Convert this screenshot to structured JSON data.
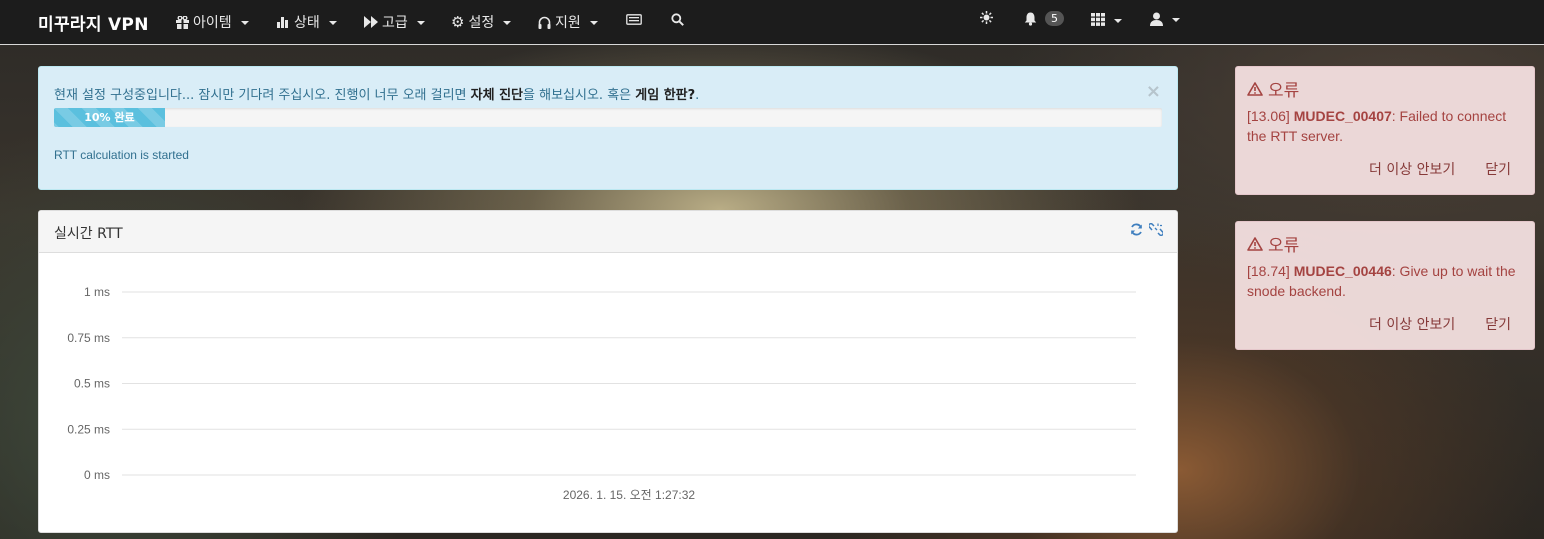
{
  "navbar": {
    "brand": "미꾸라지 VPN",
    "menus": [
      {
        "label": "아이템",
        "icon": "gift-icon"
      },
      {
        "label": "상태",
        "icon": "bar-chart-icon"
      },
      {
        "label": "고급",
        "icon": "forward-icon"
      },
      {
        "label": "설정",
        "icon": "gear-icon"
      },
      {
        "label": "지원",
        "icon": "headphones-icon"
      }
    ],
    "notification_count": "5"
  },
  "progress_alert": {
    "text_before": "현재 설정 구성중입니다... 잠시만 기다려 주십시오. 진행이 너무 오래 걸리면 ",
    "link_self_diagnosis": "자체 진단",
    "text_middle": "을 해보십시오. 혹은 ",
    "link_game": "게임 한판?",
    "text_end": ".",
    "close_symbol": "×",
    "progress_percent": 10,
    "progress_label": "10% 완료",
    "status": "RTT calculation is started"
  },
  "rtt_panel": {
    "title": "실시간 RTT"
  },
  "chart_data": {
    "type": "line",
    "title": "",
    "xlabel": "",
    "ylabel": "",
    "ylim": [
      0,
      1
    ],
    "y_ticks": [
      "1 ms",
      "0.75 ms",
      "0.5 ms",
      "0.25 ms",
      "0 ms"
    ],
    "x_ticks": [
      "2026. 1. 15. 오전 1:27:32"
    ],
    "grid": true,
    "series": []
  },
  "errors": [
    {
      "title": "오류",
      "time": "[13.06]",
      "code": "MUDEC_00407",
      "message": ": Failed to connect the RTT server.",
      "dismiss_label": "더 이상 안보기",
      "close_label": "닫기"
    },
    {
      "title": "오류",
      "time": "[18.74]",
      "code": "MUDEC_00446",
      "message": ": Give up to wait the snode backend.",
      "dismiss_label": "더 이상 안보기",
      "close_label": "닫기"
    }
  ],
  "colors": {
    "navbar_bg": "#1c1c1c",
    "info_bg": "#d9edf7",
    "progress": "#5bc0de",
    "error_bg": "#f2dede",
    "error_text": "#a94442"
  }
}
